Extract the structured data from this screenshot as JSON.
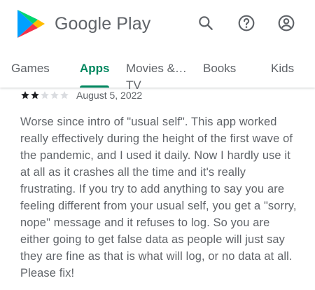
{
  "header": {
    "brand_name": "Google Play",
    "logo_icon": "google-play-logo-icon",
    "search_icon": "search-icon",
    "help_icon": "help-icon",
    "account_icon": "account-icon"
  },
  "tabs": [
    {
      "label": "Games",
      "active": false
    },
    {
      "label": "Apps",
      "active": true
    },
    {
      "label_line1": "Movies &…",
      "label_line2": "TV",
      "active": false
    },
    {
      "label": "Books",
      "active": false
    },
    {
      "label": "Kids",
      "active": false
    }
  ],
  "review": {
    "rating": 2,
    "max_rating": 5,
    "date": "August 5, 2022",
    "text": "Worse since intro of \"usual self\". This app worked really effectively during the height of the first wave of the pandemic, and I used it daily. Now I hardly use it at all as it crashes all the time and it's really frustrating. If you try to add anything to say you are feeling different from your usual self, you get a \"sorry, nope\" message and it refuses to log. So you are either going to get false data as people will just say they are fine as that is what will log, or no data at all. Please fix!"
  },
  "colors": {
    "accent": "#01875f",
    "text_secondary": "#5f6368",
    "star_filled": "#202124",
    "star_empty": "#dadce0"
  }
}
